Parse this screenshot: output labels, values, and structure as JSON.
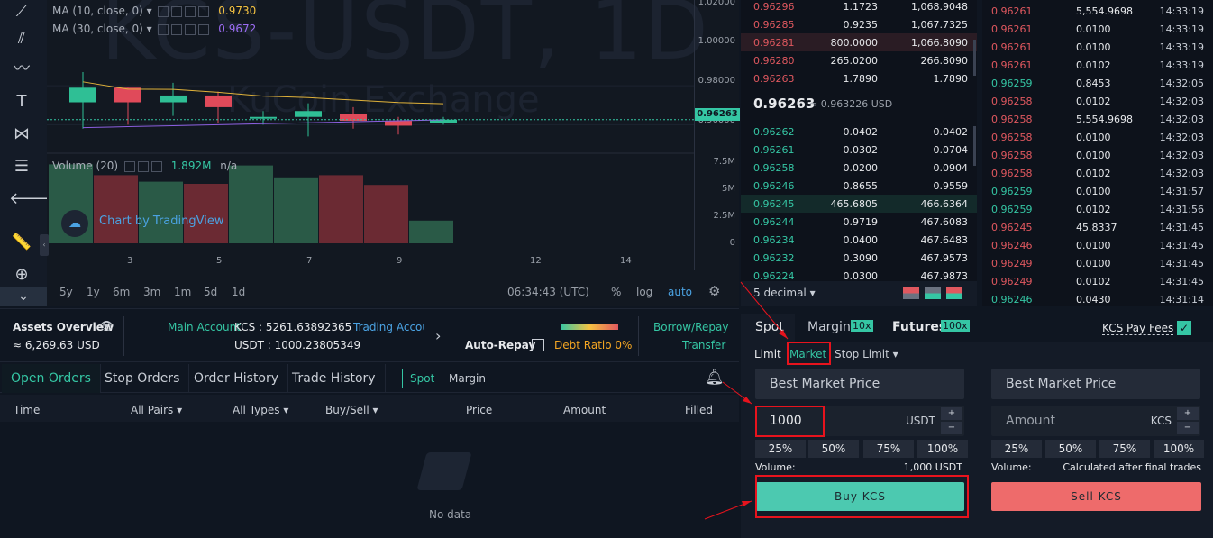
{
  "chart": {
    "watermark": "KCS-USDT, 1D",
    "watermark_sub": "KuCoin Exchange",
    "ma10_label": "MA (10, close, 0)",
    "ma10_value": "0.9730",
    "ma30_label": "MA (30, close, 0)",
    "ma30_value": "0.9672",
    "volume_label": "Volume (20)",
    "volume_value": "1.892M",
    "volume_na": "n/a",
    "tv_label": "Chart by TradingView",
    "price_ticks": [
      "1.02000",
      "1.00000",
      "0.98000",
      "0.96000"
    ],
    "current_price_tag": "0.96263",
    "volume_ticks": [
      "7.5M",
      "5M",
      "2.5M",
      "0"
    ],
    "x_ticks": [
      "3",
      "5",
      "7",
      "9",
      "12",
      "14"
    ],
    "timeframes": [
      "5y",
      "1y",
      "6m",
      "3m",
      "1m",
      "5d",
      "1d"
    ],
    "clock": "06:34:43 (UTC)",
    "pct_label": "%",
    "log_label": "log",
    "auto_label": "auto",
    "candles": [
      {
        "o": 0.9715,
        "h": 0.987,
        "l": 0.958,
        "c": 0.979,
        "dir": "up",
        "vol": 7.3
      },
      {
        "o": 0.979,
        "h": 0.979,
        "l": 0.96,
        "c": 0.9715,
        "dir": "down",
        "vol": 6.3
      },
      {
        "o": 0.9715,
        "h": 0.9815,
        "l": 0.9645,
        "c": 0.975,
        "dir": "up",
        "vol": 5.7
      },
      {
        "o": 0.975,
        "h": 0.977,
        "l": 0.961,
        "c": 0.969,
        "dir": "down",
        "vol": 5.5
      },
      {
        "o": 0.964,
        "h": 0.967,
        "l": 0.96,
        "c": 0.964,
        "dir": "up",
        "vol": 7.2
      },
      {
        "o": 0.964,
        "h": 0.971,
        "l": 0.954,
        "c": 0.967,
        "dir": "up",
        "vol": 6.1
      },
      {
        "o": 0.9655,
        "h": 0.969,
        "l": 0.958,
        "c": 0.962,
        "dir": "down",
        "vol": 6.3
      },
      {
        "o": 0.962,
        "h": 0.964,
        "l": 0.955,
        "c": 0.9595,
        "dir": "down",
        "vol": 5.4
      },
      {
        "o": 0.961,
        "h": 0.964,
        "l": 0.96,
        "c": 0.9626,
        "dir": "up",
        "vol": 2.1
      }
    ]
  },
  "orderbook": {
    "asks": [
      {
        "price": "0.96296",
        "amount": "1.1723",
        "total": "1,068.9048"
      },
      {
        "price": "0.96285",
        "amount": "0.9235",
        "total": "1,067.7325"
      },
      {
        "price": "0.96281",
        "amount": "800.0000",
        "total": "1,066.8090"
      },
      {
        "price": "0.96280",
        "amount": "265.0200",
        "total": "266.8090"
      },
      {
        "price": "0.96263",
        "amount": "1.7890",
        "total": "1.7890"
      }
    ],
    "mid_price": "0.96263",
    "mid_usd": "≈ 0.963226 USD",
    "bids": [
      {
        "price": "0.96262",
        "amount": "0.0402",
        "total": "0.0402"
      },
      {
        "price": "0.96261",
        "amount": "0.0302",
        "total": "0.0704"
      },
      {
        "price": "0.96258",
        "amount": "0.0200",
        "total": "0.0904"
      },
      {
        "price": "0.96246",
        "amount": "0.8655",
        "total": "0.9559"
      },
      {
        "price": "0.96245",
        "amount": "465.6805",
        "total": "466.6364"
      },
      {
        "price": "0.96244",
        "amount": "0.9719",
        "total": "467.6083"
      },
      {
        "price": "0.96234",
        "amount": "0.0400",
        "total": "467.6483"
      },
      {
        "price": "0.96232",
        "amount": "0.3090",
        "total": "467.9573"
      },
      {
        "price": "0.96224",
        "amount": "0.0300",
        "total": "467.9873"
      }
    ],
    "decimal_label": "5 decimal"
  },
  "trades": [
    {
      "price": "0.96261",
      "amount": "5,554.9698",
      "time": "14:33:19",
      "side": "red"
    },
    {
      "price": "0.96261",
      "amount": "0.0100",
      "time": "14:33:19",
      "side": "red"
    },
    {
      "price": "0.96261",
      "amount": "0.0100",
      "time": "14:33:19",
      "side": "red"
    },
    {
      "price": "0.96261",
      "amount": "0.0102",
      "time": "14:33:19",
      "side": "red"
    },
    {
      "price": "0.96259",
      "amount": "0.8453",
      "time": "14:32:05",
      "side": "green"
    },
    {
      "price": "0.96258",
      "amount": "0.0102",
      "time": "14:32:03",
      "side": "red"
    },
    {
      "price": "0.96258",
      "amount": "5,554.9698",
      "time": "14:32:03",
      "side": "red"
    },
    {
      "price": "0.96258",
      "amount": "0.0100",
      "time": "14:32:03",
      "side": "red"
    },
    {
      "price": "0.96258",
      "amount": "0.0100",
      "time": "14:32:03",
      "side": "red"
    },
    {
      "price": "0.96258",
      "amount": "0.0102",
      "time": "14:32:03",
      "side": "red"
    },
    {
      "price": "0.96259",
      "amount": "0.0100",
      "time": "14:31:57",
      "side": "green"
    },
    {
      "price": "0.96259",
      "amount": "0.0102",
      "time": "14:31:56",
      "side": "green"
    },
    {
      "price": "0.96245",
      "amount": "45.8337",
      "time": "14:31:45",
      "side": "red"
    },
    {
      "price": "0.96246",
      "amount": "0.0100",
      "time": "14:31:45",
      "side": "red"
    },
    {
      "price": "0.96249",
      "amount": "0.0100",
      "time": "14:31:45",
      "side": "red"
    },
    {
      "price": "0.96249",
      "amount": "0.0102",
      "time": "14:31:45",
      "side": "red"
    },
    {
      "price": "0.96246",
      "amount": "0.0430",
      "time": "14:31:14",
      "side": "green"
    }
  ],
  "assets": {
    "title": "Assets Overview",
    "total": "≈ 6,269.63 USD",
    "main_account_label": "Main Account",
    "main_kcs": "KCS : 5261.63892365",
    "main_usdt": "USDT : 1000.23805349",
    "trading_account": "Trading Accou",
    "auto_repay": "Auto-Repay",
    "debt_ratio": "Debt Ratio 0%",
    "borrow_repay": "Borrow/Repay",
    "transfer": "Transfer"
  },
  "orders": {
    "tabs": [
      "Open Orders",
      "Stop Orders",
      "Order History",
      "Trade History"
    ],
    "spot": "Spot",
    "margin": "Margin",
    "columns": {
      "time": "Time",
      "pairs": "All Pairs",
      "types": "All Types",
      "side": "Buy/Sell",
      "price": "Price",
      "amount": "Amount",
      "filled": "Filled"
    },
    "empty": "No data"
  },
  "trade": {
    "tab_spot": "Spot",
    "tab_margin": "Margin",
    "margin_badge": "10x",
    "tab_futures": "Futures",
    "futures_badge": "100x",
    "kcs_pay_fees": "KCS Pay Fees",
    "order_types": {
      "limit": "Limit",
      "market": "Market",
      "stop_limit": "Stop Limit"
    },
    "buy": {
      "price_placeholder": "Best Market Price",
      "amount_value": "1000",
      "amount_unit": "USDT",
      "volume_label": "Volume:",
      "volume_value": "1,000 USDT",
      "button": "Buy KCS"
    },
    "sell": {
      "price_placeholder": "Best Market Price",
      "amount_placeholder": "Amount",
      "amount_unit": "KCS",
      "volume_label": "Volume:",
      "volume_value": "Calculated after final trades",
      "button": "Sell KCS"
    },
    "percents": [
      "25%",
      "50%",
      "75%",
      "100%"
    ]
  }
}
